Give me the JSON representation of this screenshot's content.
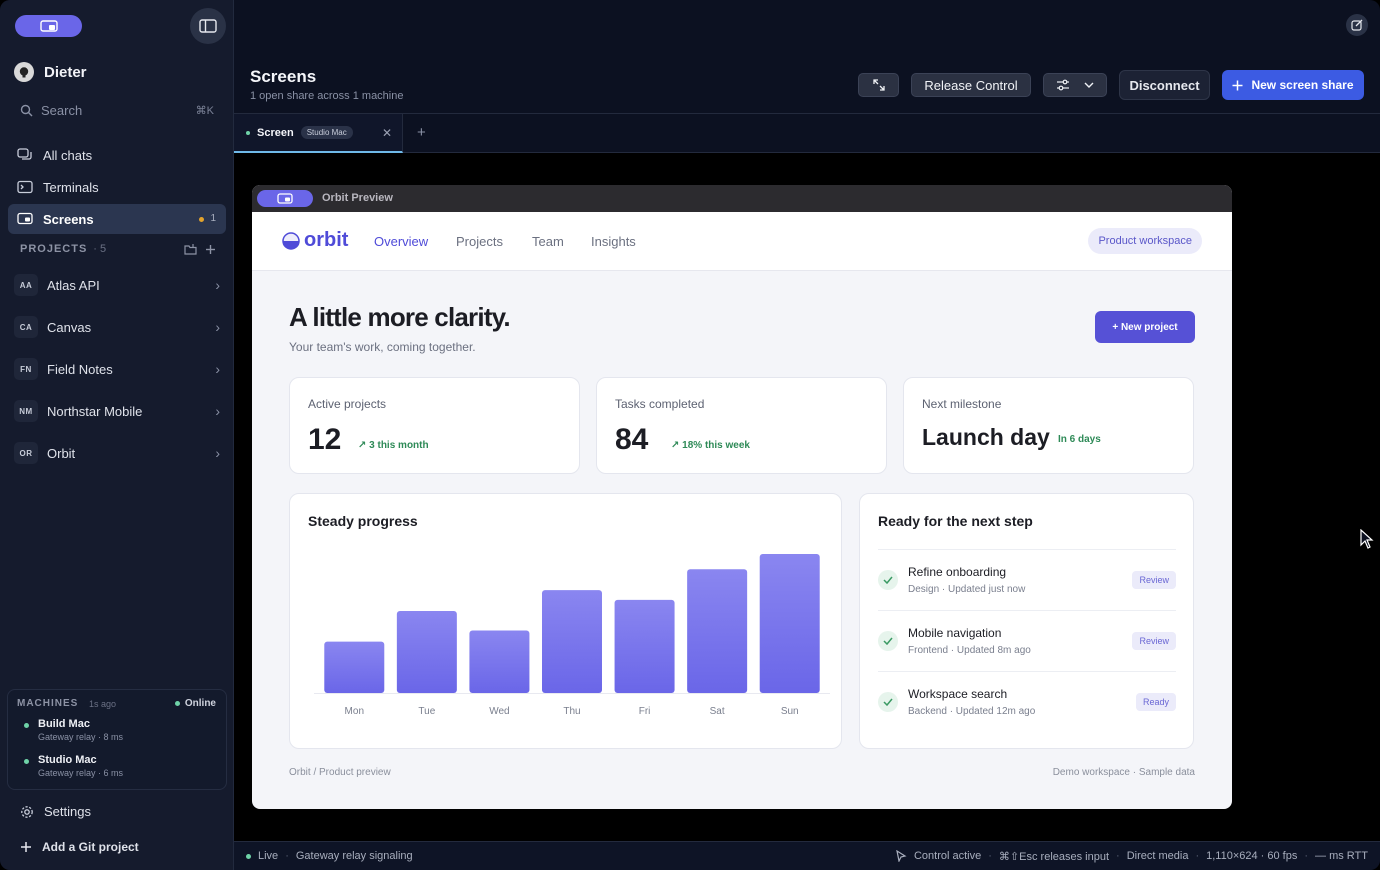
{
  "sidebar": {
    "user": "Dieter",
    "search": {
      "label": "Search",
      "shortcut": "⌘K"
    },
    "nav": [
      {
        "label": "All chats",
        "icon": "chat-icon"
      },
      {
        "label": "Terminals",
        "icon": "terminal-icon"
      },
      {
        "label": "Screens",
        "icon": "screen-icon",
        "active": true,
        "count": "1"
      }
    ],
    "projects_header": {
      "label": "PROJECTS",
      "count": "· 5"
    },
    "projects": [
      {
        "abbr": "AA",
        "name": "Atlas API"
      },
      {
        "abbr": "CA",
        "name": "Canvas"
      },
      {
        "abbr": "FN",
        "name": "Field Notes"
      },
      {
        "abbr": "NM",
        "name": "Northstar Mobile"
      },
      {
        "abbr": "OR",
        "name": "Orbit"
      }
    ],
    "machines": {
      "label": "MACHINES",
      "updated": "1s ago",
      "status": "Online",
      "items": [
        {
          "name": "Build Mac",
          "sub": "Gateway relay · 8 ms"
        },
        {
          "name": "Studio Mac",
          "sub": "Gateway relay · 6 ms"
        }
      ]
    },
    "settings": "Settings",
    "add_project": "Add a Git project"
  },
  "header": {
    "title": "Screens",
    "subtitle": "1 open share across 1 machine",
    "release_control": "Release Control",
    "disconnect": "Disconnect",
    "new_share": "New screen share"
  },
  "tabs": [
    {
      "name": "Screen",
      "badge": "Studio Mac"
    }
  ],
  "remote": {
    "window_title": "Orbit Preview",
    "logo": "orbit",
    "nav": [
      "Overview",
      "Projects",
      "Team",
      "Insights"
    ],
    "workspace": "Product workspace",
    "hero_title": "A little more clarity.",
    "hero_sub": "Your team's work, coming together.",
    "new_project": "+ New project",
    "stats": [
      {
        "label": "Active projects",
        "value": "12",
        "delta": "↗ 3 this month"
      },
      {
        "label": "Tasks completed",
        "value": "84",
        "delta": "↗ 18% this week"
      },
      {
        "label": "Next milestone",
        "value": "Launch day",
        "delta": "In 6 days"
      }
    ],
    "tasks_title": "Ready for the next step",
    "tasks": [
      {
        "name": "Refine onboarding",
        "meta": "Design · Updated just now",
        "badge": "Review"
      },
      {
        "name": "Mobile navigation",
        "meta": "Frontend · Updated 8m ago",
        "badge": "Review"
      },
      {
        "name": "Workspace search",
        "meta": "Backend · Updated 12m ago",
        "badge": "Ready"
      }
    ],
    "footer_left": "Orbit / Product preview",
    "footer_right": "Demo workspace · Sample data"
  },
  "chart_data": {
    "type": "bar",
    "title": "Steady progress",
    "categories": [
      "Mon",
      "Tue",
      "Wed",
      "Thu",
      "Fri",
      "Sat",
      "Sun"
    ],
    "values": [
      37,
      59,
      45,
      74,
      67,
      89,
      100
    ],
    "ylim": [
      0,
      100
    ],
    "grid": false,
    "color": "#6a66e8"
  },
  "status": {
    "live": "Live",
    "signaling": "Gateway relay signaling",
    "control": "Control active",
    "release_hint": "⌘⇧Esc releases input",
    "media": "Direct media",
    "resolution": "1,110×624 · 60 fps",
    "rtt": "— ms RTT"
  }
}
